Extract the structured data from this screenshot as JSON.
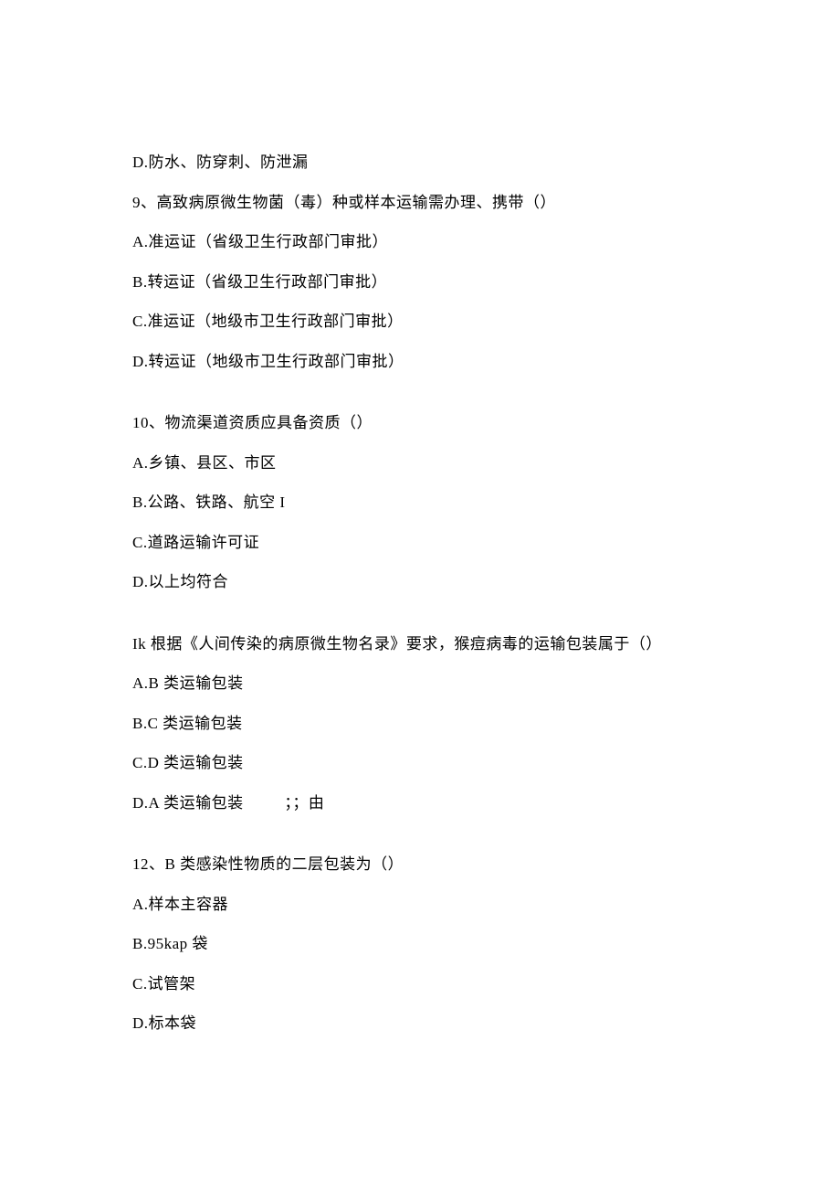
{
  "q8": {
    "optD": "D.防水、防穿刺、防泄漏"
  },
  "q9": {
    "stem": "9、高致病原微生物菌（毒）种或样本运输需办理、携带（）",
    "optA": "A.准运证（省级卫生行政部门审批）",
    "optB": "B.转运证（省级卫生行政部门审批）",
    "optC": "C.准运证（地级市卫生行政部门审批）",
    "optD": "D.转运证（地级市卫生行政部门审批）"
  },
  "q10": {
    "stem": "10、物流渠道资质应具备资质（）",
    "optA": "A.乡镇、县区、市区",
    "optB": "B.公路、铁路、航空 I",
    "optC": "C.道路运输许可证",
    "optD": "D.以上均符合"
  },
  "q11": {
    "stem": "Ik 根据《人间传染的病原微生物名录》要求，猴痘病毒的运输包装属于（）",
    "optA": "A.B 类运输包装",
    "optB": "B.C 类运输包装",
    "optC": "C.D 类运输包装",
    "optD": "D.A 类运输包装",
    "optD_suffix": "；；由"
  },
  "q12": {
    "stem": "12、B 类感染性物质的二层包装为（）",
    "optA": "A.样本主容器",
    "optB": "B.95kap 袋",
    "optC": "C.试管架",
    "optD": "D.标本袋"
  }
}
